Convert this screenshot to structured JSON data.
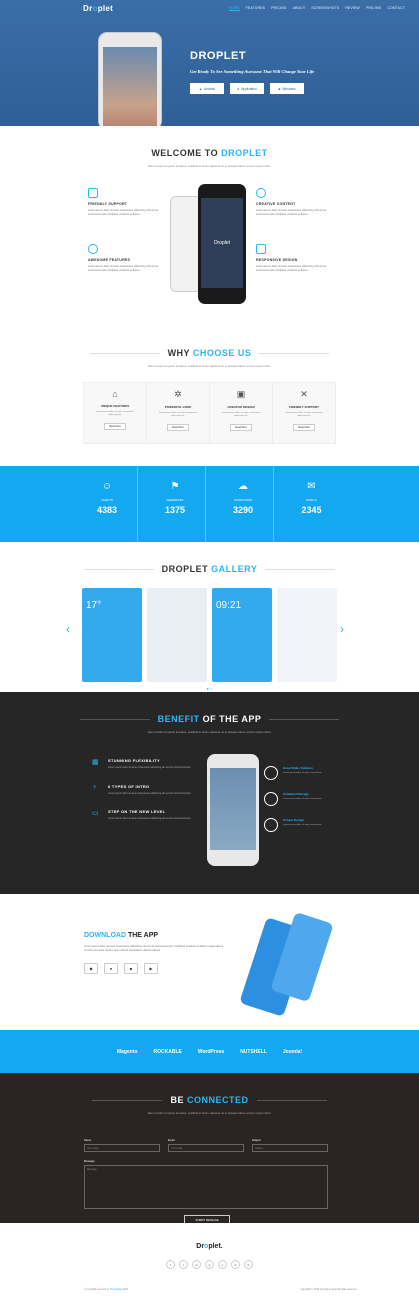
{
  "header": {
    "logo_main": "Dr",
    "logo_o": "o",
    "logo_rest": "plet",
    "nav": [
      "HOME",
      "FEATURES",
      "PRICING",
      "ABOUT",
      "SCREENSHOTS",
      "REVIEW",
      "PRICING",
      "CONTACT"
    ],
    "hero_title": "DROPLET",
    "hero_sub": "Get Ready To See Something Awesome That Will Change Your Life",
    "buttons": [
      "Android",
      "Application",
      "Windows"
    ]
  },
  "welcome": {
    "title_a": "WELCOME TO",
    "title_b": "DROPLET",
    "sub": "Nam et dolor et ipsum inceptos, vestibulum lorem sapiente ac et quisque libero a lorem ipsum dolor.",
    "features": [
      {
        "title": "FRIENDLY SUPPORT",
        "text": "Lorem ipsum dolor sit amet consectetur adipiscing elit sed do eiusmod tempor incididunt ut labore et dolore."
      },
      {
        "title": "CREATIVE CONTENT",
        "text": "Lorem ipsum dolor sit amet consectetur adipiscing elit sed do eiusmod tempor incididunt ut labore et dolore."
      },
      {
        "title": "AWESOME FEATURES",
        "text": "Lorem ipsum dolor sit amet consectetur adipiscing elit sed do eiusmod tempor incididunt ut labore et dolore."
      },
      {
        "title": "RESPONSIVE DESIGN",
        "text": "Lorem ipsum dolor sit amet consectetur adipiscing elit sed do eiusmod tempor incididunt ut labore et dolore."
      }
    ],
    "phone_label": "Droplet"
  },
  "why": {
    "title_a": "WHY",
    "title_b": "CHOOSE US",
    "sub": "Nam et dolor et ipsum inceptos, vestibulum lorem sapiente ac et quisque libero a lorem ipsum dolor.",
    "items": [
      {
        "title": "UNIQUE FEATURES",
        "text": "Lorem ipsum dolor sit amet consectetur adipiscing elit.",
        "btn": "Read More"
      },
      {
        "title": "POWERFUL CODE",
        "text": "Lorem ipsum dolor sit amet consectetur adipiscing elit.",
        "btn": "Read More"
      },
      {
        "title": "CREATIVE DESIGN",
        "text": "Lorem ipsum dolor sit amet consectetur adipiscing elit.",
        "btn": "Read More"
      },
      {
        "title": "FRIENDLY SUPPORT",
        "text": "Lorem ipsum dolor sit amet consectetur adipiscing elit.",
        "btn": "Read More"
      }
    ]
  },
  "stats": [
    {
      "label": "CLIENTS",
      "value": "4383"
    },
    {
      "label": "FEEDBACKS",
      "value": "1375"
    },
    {
      "label": "DOWNLOADS",
      "value": "3290"
    },
    {
      "label": "EMAILS",
      "value": "2345"
    }
  ],
  "gallery": {
    "title_a": "DROPLET",
    "title_b": "GALLERY",
    "captions": [
      "17°",
      "",
      "09:21",
      ""
    ]
  },
  "benefit": {
    "title_a": "BENEFIT",
    "title_b": "OF THE APP",
    "sub": "Nam et dolor et ipsum inceptos, vestibulum lorem sapiente ac et quisque libero a lorem ipsum dolor.",
    "left": [
      {
        "title": "STUNNING FLEXIBILITY",
        "text": "Lorem ipsum dolor sit amet consectetur adipiscing elit sed do eiusmod tempor."
      },
      {
        "title": "6 TYPES OF INTRO",
        "text": "Lorem ipsum dolor sit amet consectetur adipiscing elit sed do eiusmod tempor."
      },
      {
        "title": "STEP ON THE NEW LEVEL",
        "text": "Lorem ipsum dolor sit amet consectetur adipiscing elit sed do eiusmod tempor."
      }
    ],
    "right": [
      {
        "title": "Great Slider Solution",
        "text": "Lorem ipsum dolor sit amet consectetur."
      },
      {
        "title": "Unlimited Storage",
        "text": "Lorem ipsum dolor sit amet consectetur."
      },
      {
        "title": "Unique Design",
        "text": "Lorem ipsum dolor sit amet consectetur."
      }
    ]
  },
  "download": {
    "title_a": "DOWNLOAD",
    "title_b": "THE APP",
    "text": "Lorem ipsum dolor sit amet consectetur adipiscing elit sed do eiusmod tempor incididunt ut labore et dolore magna aliqua. Ut enim ad minim veniam quis nostrud exercitation ullamco laboris."
  },
  "partners": [
    "Magento",
    "ROCKABLE",
    "WordPress",
    "NUTSHELL",
    "Joomla!"
  ],
  "contact": {
    "title_a": "BE",
    "title_b": "CONNECTED",
    "sub": "Nam et dolor et ipsum inceptos, vestibulum lorem sapiente ac et quisque libero a lorem ipsum dolor.",
    "fields": [
      {
        "label": "Name",
        "placeholder": "Your name"
      },
      {
        "label": "Email",
        "placeholder": "Your email"
      },
      {
        "label": "Subject",
        "placeholder": "Subject"
      }
    ],
    "message_label": "Message",
    "message_placeholder": "Message",
    "submit": "SUBMIT MESSAGE"
  },
  "footer": {
    "logo_main": "Dr",
    "logo_o": "o",
    "logo_rest": "plet.",
    "social": [
      "f",
      "t",
      "in",
      "g",
      "p",
      "d",
      "b"
    ],
    "left_a": "© copyright reserved to",
    "left_b": "The Droplet",
    "left_c": "2015",
    "right": "Copyright © 2015 Company name All rights reserved."
  }
}
